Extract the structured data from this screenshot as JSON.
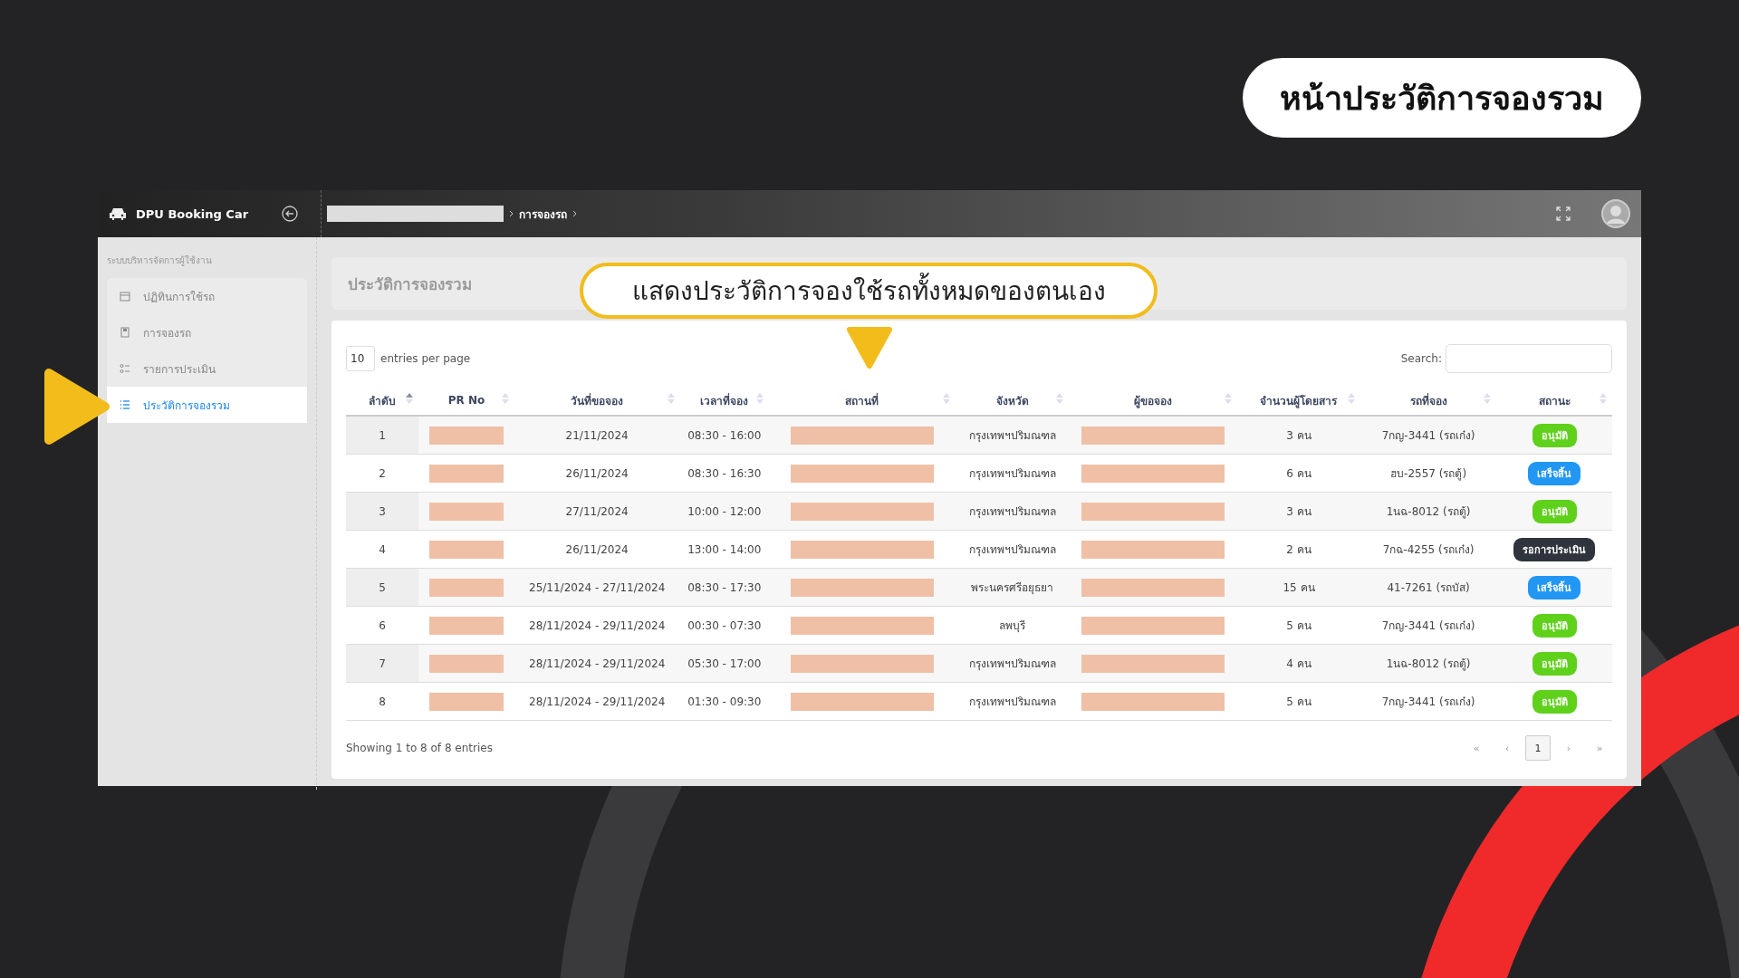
{
  "slide_title": "หน้าประวัติการจองรวม",
  "callout": "แสดงประวัติการจองใช้รถทั้งหมดของตนเอง",
  "app": {
    "brand": "DPU Booking Car",
    "breadcrumb": [
      "การจองรถ"
    ],
    "sidebar": {
      "section": "ระบบบริหารจัดการผู้ใช้งาน",
      "items": [
        {
          "label": "ปฏิทินการใช้รถ",
          "selected": false
        },
        {
          "label": "การจองรถ",
          "selected": false
        },
        {
          "label": "รายการประเมิน",
          "selected": false
        },
        {
          "label": "ประวัติการจองรวม",
          "selected": true
        }
      ]
    },
    "page_title": "ประวัติการจองรวม",
    "table": {
      "page_size": "10",
      "page_size_label": "entries per page",
      "search_label": "Search:",
      "columns": [
        {
          "label": "ลำดับ",
          "sorted": true
        },
        {
          "label": "PR No",
          "sorted": false
        },
        {
          "label": "วันที่ขอจอง",
          "sorted": false
        },
        {
          "label": "เวลาที่จอง",
          "sorted": false
        },
        {
          "label": "สถานที่",
          "sorted": false
        },
        {
          "label": "จังหวัด",
          "sorted": false
        },
        {
          "label": "ผู้ขอจอง",
          "sorted": false
        },
        {
          "label": "จำนวนผู้โดยสาร",
          "sorted": false
        },
        {
          "label": "รถที่จอง",
          "sorted": false
        },
        {
          "label": "สถานะ",
          "sorted": false
        }
      ],
      "rows": [
        {
          "no": "1",
          "date": "21/11/2024",
          "time": "08:30 - 16:00",
          "province": "กรุงเทพฯปริมณฑล",
          "passengers": "3 คน",
          "car": "7กญ-3441 (รถเก๋ง)",
          "status": {
            "label": "อนุมัติ",
            "kind": "approved"
          }
        },
        {
          "no": "2",
          "date": "26/11/2024",
          "time": "08:30 - 16:30",
          "province": "กรุงเทพฯปริมณฑล",
          "passengers": "6 คน",
          "car": "ฮบ-2557 (รถตู้)",
          "status": {
            "label": "เสร็จสิ้น",
            "kind": "done"
          }
        },
        {
          "no": "3",
          "date": "27/11/2024",
          "time": "10:00 - 12:00",
          "province": "กรุงเทพฯปริมณฑล",
          "passengers": "3 คน",
          "car": "1นฉ-8012 (รถตู้)",
          "status": {
            "label": "อนุมัติ",
            "kind": "approved"
          }
        },
        {
          "no": "4",
          "date": "26/11/2024",
          "time": "13:00 - 14:00",
          "province": "กรุงเทพฯปริมณฑล",
          "passengers": "2 คน",
          "car": "7กฉ-4255 (รถเก๋ง)",
          "status": {
            "label": "รอการประเมิน",
            "kind": "pending"
          }
        },
        {
          "no": "5",
          "date": "25/11/2024 - 27/11/2024",
          "time": "08:30 - 17:30",
          "province": "พระนครศรีอยุธยา",
          "passengers": "15 คน",
          "car": "41-7261 (รถบัส)",
          "status": {
            "label": "เสร็จสิ้น",
            "kind": "done"
          }
        },
        {
          "no": "6",
          "date": "28/11/2024 - 29/11/2024",
          "time": "00:30 - 07:30",
          "province": "ลพบุรี",
          "passengers": "5 คน",
          "car": "7กญ-3441 (รถเก๋ง)",
          "status": {
            "label": "อนุมัติ",
            "kind": "approved"
          }
        },
        {
          "no": "7",
          "date": "28/11/2024 - 29/11/2024",
          "time": "05:30 - 17:00",
          "province": "กรุงเทพฯปริมณฑล",
          "passengers": "4 คน",
          "car": "1นฉ-8012 (รถตู้)",
          "status": {
            "label": "อนุมัติ",
            "kind": "approved"
          }
        },
        {
          "no": "8",
          "date": "28/11/2024 - 29/11/2024",
          "time": "01:30 - 09:30",
          "province": "กรุงเทพฯปริมณฑล",
          "passengers": "5 คน",
          "car": "7กญ-3441 (รถเก๋ง)",
          "status": {
            "label": "อนุมัติ",
            "kind": "approved"
          }
        }
      ],
      "info": "Showing 1 to 8 of 8 entries",
      "pagination": [
        {
          "label": "«",
          "selected": false
        },
        {
          "label": "‹",
          "selected": false
        },
        {
          "label": "1",
          "selected": true
        },
        {
          "label": "›",
          "selected": false
        },
        {
          "label": "»",
          "selected": false
        }
      ]
    }
  }
}
